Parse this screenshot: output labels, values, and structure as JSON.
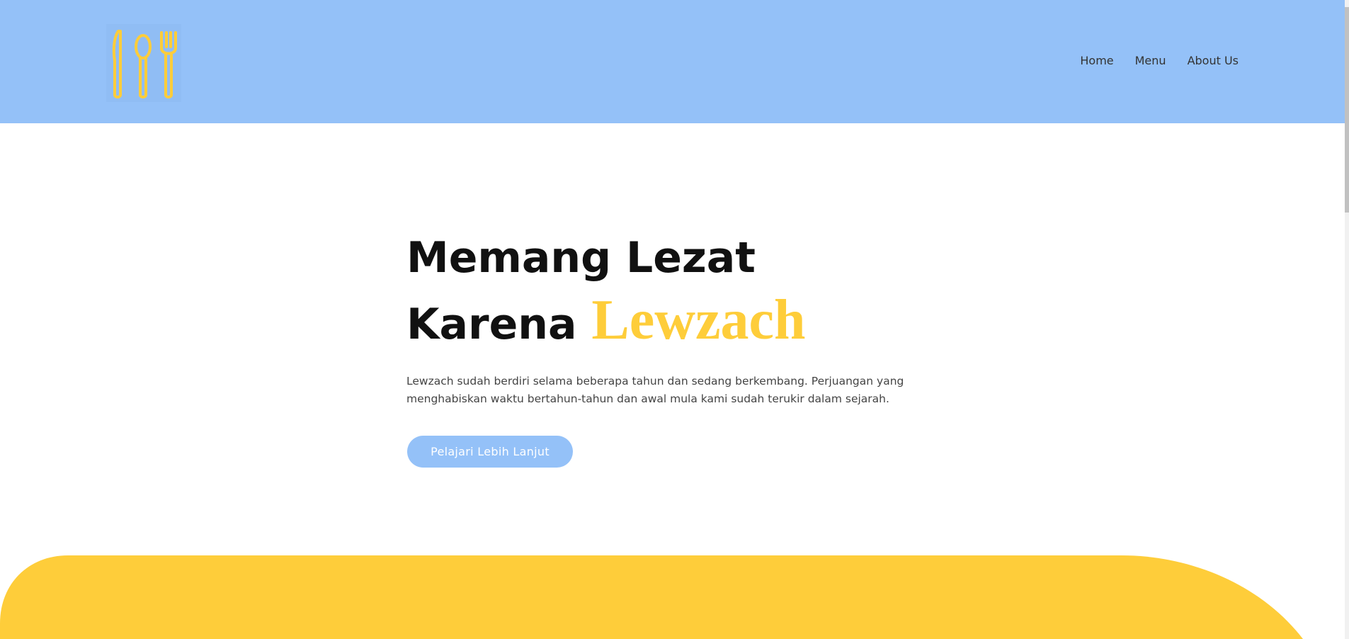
{
  "header": {
    "logo_icon": "utensils-icon",
    "nav": [
      {
        "label": "Home"
      },
      {
        "label": "Menu"
      },
      {
        "label": "About Us"
      }
    ]
  },
  "hero": {
    "title_line1": "Memang Lezat",
    "title_line2_prefix": "Karena ",
    "brand": "Lewzach",
    "description": "Lewzach sudah berdiri selama beberapa tahun dan sedang berkembang. Perjuangan yang menghabiskan waktu bertahun-tahun dan awal mula kami sudah terukir dalam sejarah.",
    "cta_label": "Pelajari Lebih Lanjut"
  },
  "colors": {
    "header_bg": "#94c1f8",
    "accent_yellow": "#fecd3a",
    "button_bg": "#94c1f8",
    "text_dark": "#111111"
  }
}
